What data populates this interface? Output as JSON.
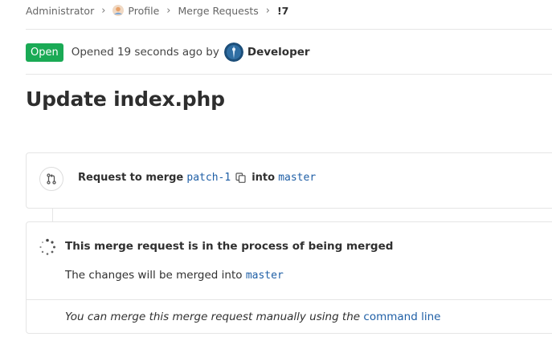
{
  "breadcrumb": {
    "root": "Administrator",
    "profile": "Profile",
    "section": "Merge Requests",
    "current": "!7",
    "separator": "›"
  },
  "header": {
    "status_badge": "Open",
    "opened_text": "Opened 19 seconds ago by",
    "author": "Developer"
  },
  "title": "Update index.php",
  "branch_info": {
    "request_label": "Request to merge",
    "source_branch": "patch-1",
    "into_label": "into",
    "target_branch": "master"
  },
  "merge_status": {
    "title": "This merge request is in the process of being merged",
    "desc_prefix": "The changes will be merged into",
    "desc_branch": "master",
    "manual_text": "You can merge this merge request manually using the",
    "manual_link": "command line"
  },
  "colors": {
    "open_badge": "#1aaa55",
    "link": "#1f5fa6",
    "border": "#e5e5e5"
  },
  "icons": {
    "merge_request": "merge-request-icon",
    "copy": "copy-icon",
    "spinner": "loading-spinner-icon",
    "avatar": "user-avatar"
  }
}
